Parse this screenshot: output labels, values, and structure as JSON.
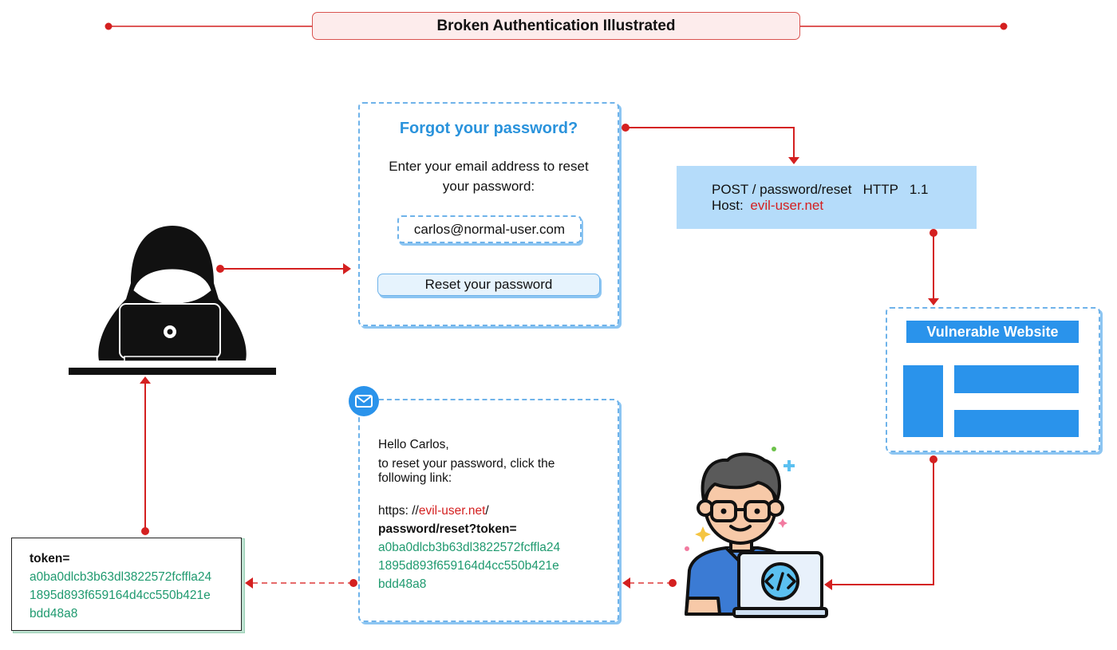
{
  "title": "Broken Authentication Illustrated",
  "forgot_password": {
    "heading": "Forgot your password?",
    "description": "Enter your email address to reset your password:",
    "email_value": "carlos@normal-user.com",
    "button_label": "Reset your password"
  },
  "http_request": {
    "line1": "POST / password/reset   HTTP   1.1",
    "host_label": "Host:",
    "host_value": "evil-user.net"
  },
  "vulnerable_site": {
    "header": "Vulnerable Website"
  },
  "email": {
    "greeting": "Hello Carlos,",
    "line1": "to reset your password, click the",
    "line2": "following link:",
    "url_prefix": "https: //",
    "url_host": "evil-user.net",
    "url_slash": "/",
    "url_path": "password/reset?token=",
    "token_lines": [
      "a0ba0dlcb3b63dl3822572fcffla24",
      "1895d893f659164d4cc550b421e",
      "bdd48a8"
    ]
  },
  "token_box": {
    "label": "token=",
    "token_lines": [
      "a0ba0dlcb3b63dl3822572fcffla24",
      "1895d893f659164d4cc550b421e",
      "bdd48a8"
    ]
  },
  "icons": {
    "hacker": "hacker-icon",
    "developer": "developer-icon",
    "mail": "mail-icon",
    "code": "code-icon"
  },
  "colors": {
    "accent_red": "#d42020",
    "accent_blue": "#2a93eb",
    "token_green": "#1f9a6f",
    "request_bg": "#b5dcfa",
    "title_bg": "#fdecec"
  }
}
